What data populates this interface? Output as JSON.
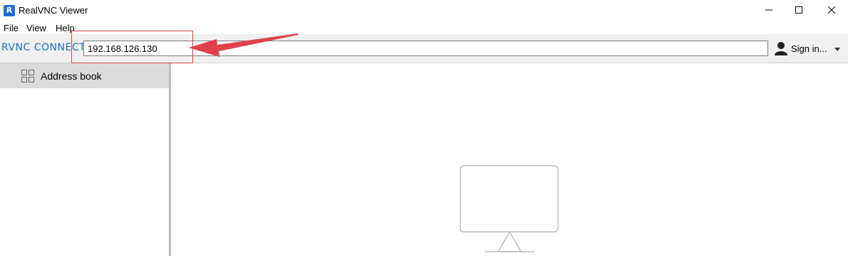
{
  "window": {
    "title": "RealVNC Viewer",
    "app_icon_glyph": "R"
  },
  "menubar": {
    "items": [
      "File",
      "View",
      "Help"
    ]
  },
  "toolbar": {
    "brand": "RVNC CONNECT",
    "address_value": "192.168.126.130",
    "signin_label": "Sign in...",
    "signin_caret": "▾"
  },
  "sidebar": {
    "items": [
      {
        "label": "Address book",
        "icon": "grid-icon"
      }
    ]
  },
  "main": {
    "icon": "monitor-icon"
  },
  "annotation": {
    "color": "#e0404a"
  },
  "colors": {
    "brand": "#1d6fd1",
    "selected_item_bg": "#dcdcdc",
    "toolbar_bg": "#f0f0f0"
  }
}
